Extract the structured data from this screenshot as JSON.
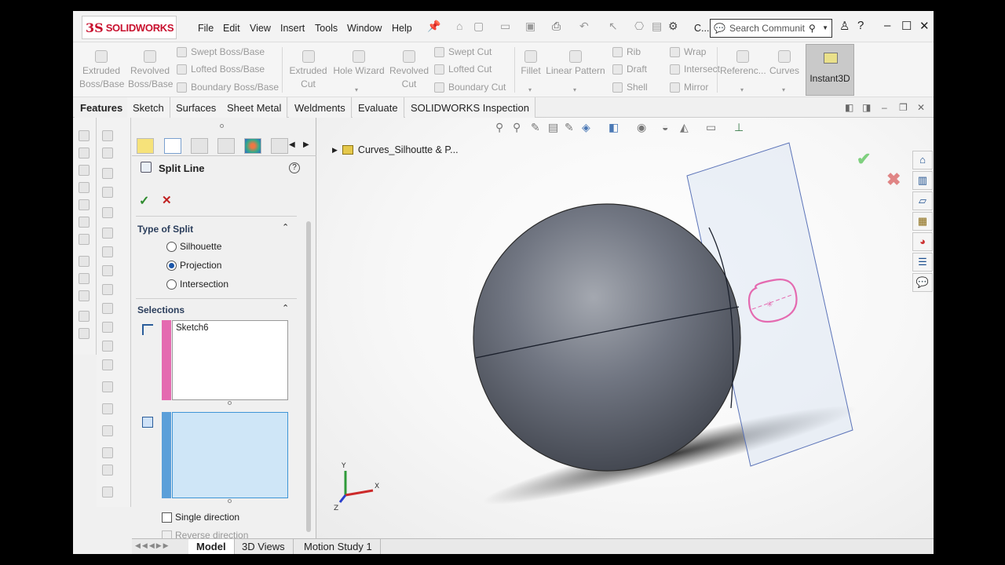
{
  "app": {
    "logo_text": "SOLIDWORKS",
    "logo_mark": "3S"
  },
  "menu": [
    "File",
    "Edit",
    "View",
    "Insert",
    "Tools",
    "Window",
    "Help"
  ],
  "search": {
    "placeholder": "Search Communit"
  },
  "title_extra": "C...",
  "ribbon": {
    "extruded_boss": "Extruded Boss/Base",
    "revolved_boss": "Revolved Boss/Base",
    "swept_boss": "Swept Boss/Base",
    "lofted_boss": "Lofted Boss/Base",
    "boundary_boss": "Boundary Boss/Base",
    "extruded_cut": "Extruded Cut",
    "hole_wizard": "Hole Wizard",
    "revolved_cut": "Revolved Cut",
    "swept_cut": "Swept Cut",
    "lofted_cut": "Lofted Cut",
    "boundary_cut": "Boundary Cut",
    "fillet": "Fillet",
    "linear_pattern": "Linear Pattern",
    "rib": "Rib",
    "draft": "Draft",
    "shell": "Shell",
    "wrap": "Wrap",
    "intersect": "Intersect",
    "mirror": "Mirror",
    "reference": "Referenc...",
    "curves": "Curves",
    "instant3d": "Instant3D"
  },
  "tabs": [
    "Features",
    "Sketch",
    "Surfaces",
    "Sheet Metal",
    "Weldments",
    "Evaluate",
    "SOLIDWORKS Inspection"
  ],
  "property_manager": {
    "title": "Split Line",
    "help": "?",
    "ok": "✓",
    "cancel": "✕",
    "type_of_split": {
      "header": "Type of Split",
      "options": [
        "Silhouette",
        "Projection",
        "Intersection"
      ],
      "selected": "Projection"
    },
    "selections": {
      "header": "Selections",
      "sketch_item": "Sketch6",
      "sketch_color": "#e46ab0",
      "face_color": "#5b9fd9"
    },
    "single_direction": "Single direction",
    "reverse_direction": "Reverse direction"
  },
  "viewport": {
    "breadcrumb": "Curves_Silhoutte & P...",
    "ok_color": "#7fd07f",
    "cancel_color": "#e08585"
  },
  "triad": {
    "x": "X",
    "y": "Y",
    "z": "Z"
  },
  "bottom_tabs": [
    "Model",
    "3D Views",
    "Motion Study 1"
  ]
}
